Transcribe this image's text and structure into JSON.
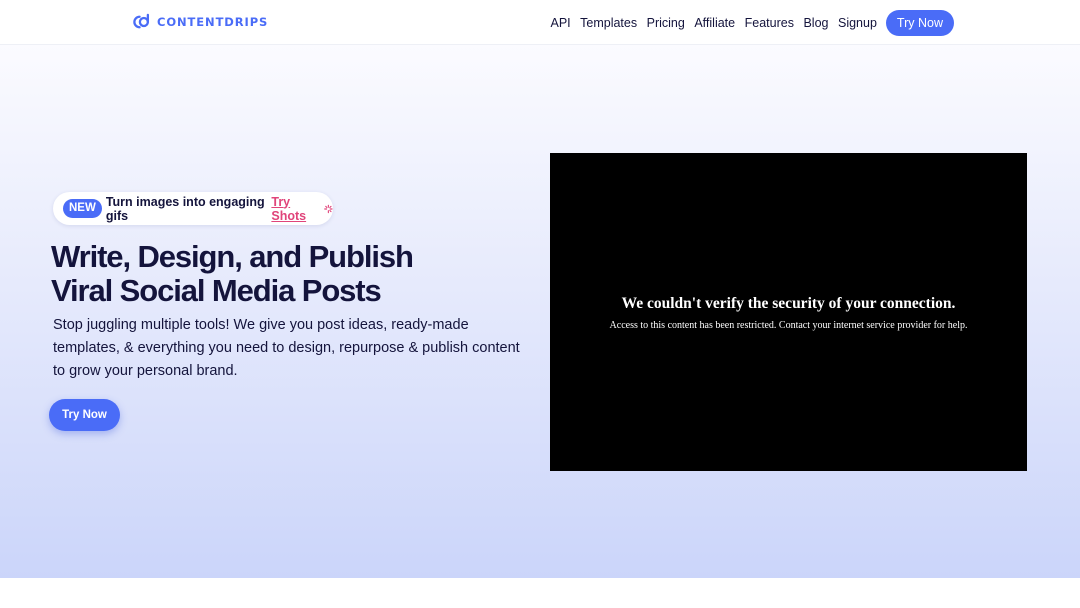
{
  "brand": {
    "name": "CONTENTDRIPS",
    "color": "#4a6cf7"
  },
  "nav": {
    "links": [
      "API",
      "Templates",
      "Pricing",
      "Affiliate",
      "Features",
      "Blog",
      "Signup"
    ],
    "cta": "Try Now"
  },
  "hero": {
    "announcement": {
      "badge": "NEW",
      "text": "Turn images into engaging gifs",
      "link": "Try Shots",
      "icon": "sparkle-icon"
    },
    "headline_line1": "Write, Design, and Publish",
    "headline_line2": "Viral Social Media Posts",
    "subtext": "Stop juggling multiple tools! We give you post ideas, ready-made templates, & everything you need to design, repurpose & publish content to grow your personal brand.",
    "cta": "Try Now"
  },
  "embed": {
    "title": "We couldn't verify the security of your connection.",
    "message": "Access to this content has been restricted. Contact your internet service provider for help."
  },
  "colors": {
    "accent": "#4a6cf7",
    "link_pink": "#e0447a",
    "text_dark": "#14143c"
  }
}
